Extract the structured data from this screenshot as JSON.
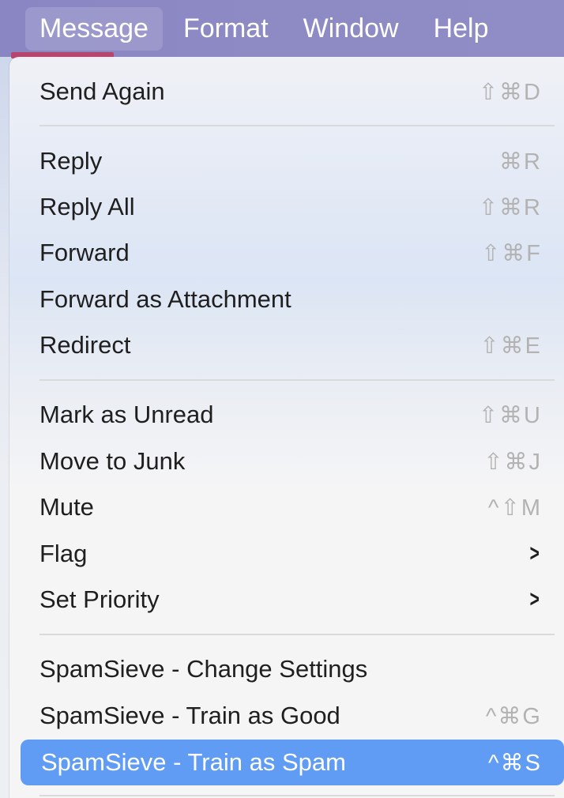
{
  "menubar": {
    "items": [
      {
        "label": "Message",
        "active": true
      },
      {
        "label": "Format"
      },
      {
        "label": "Window"
      },
      {
        "label": "Help"
      }
    ]
  },
  "menu": {
    "items": [
      {
        "label": "Send Again",
        "shortcut": "⇧⌘D"
      },
      {
        "label": "Reply",
        "shortcut": "⌘R"
      },
      {
        "label": "Reply All",
        "shortcut": "⇧⌘R"
      },
      {
        "label": "Forward",
        "shortcut": "⇧⌘F"
      },
      {
        "label": "Forward as Attachment",
        "shortcut": ""
      },
      {
        "label": "Redirect",
        "shortcut": "⇧⌘E"
      },
      {
        "label": "Mark as Unread",
        "shortcut": "⇧⌘U"
      },
      {
        "label": "Move to Junk",
        "shortcut": "⇧⌘J"
      },
      {
        "label": "Mute",
        "shortcut": "^⇧M"
      },
      {
        "label": "Flag",
        "submenu": true
      },
      {
        "label": "Set Priority",
        "submenu": true
      },
      {
        "label": "SpamSieve - Change Settings",
        "shortcut": ""
      },
      {
        "label": "SpamSieve - Train as Good",
        "shortcut": "^⌘G"
      },
      {
        "label": "SpamSieve - Train as Spam",
        "shortcut": "^⌘S",
        "highlighted": true
      }
    ],
    "submenu_glyph": ">"
  },
  "colors": {
    "menubar": "#8c88c5",
    "highlight": "#609cf3",
    "shortcut_text": "#b3b3b3",
    "separator": "#d9dadc",
    "accent_line": "#b7466f"
  }
}
